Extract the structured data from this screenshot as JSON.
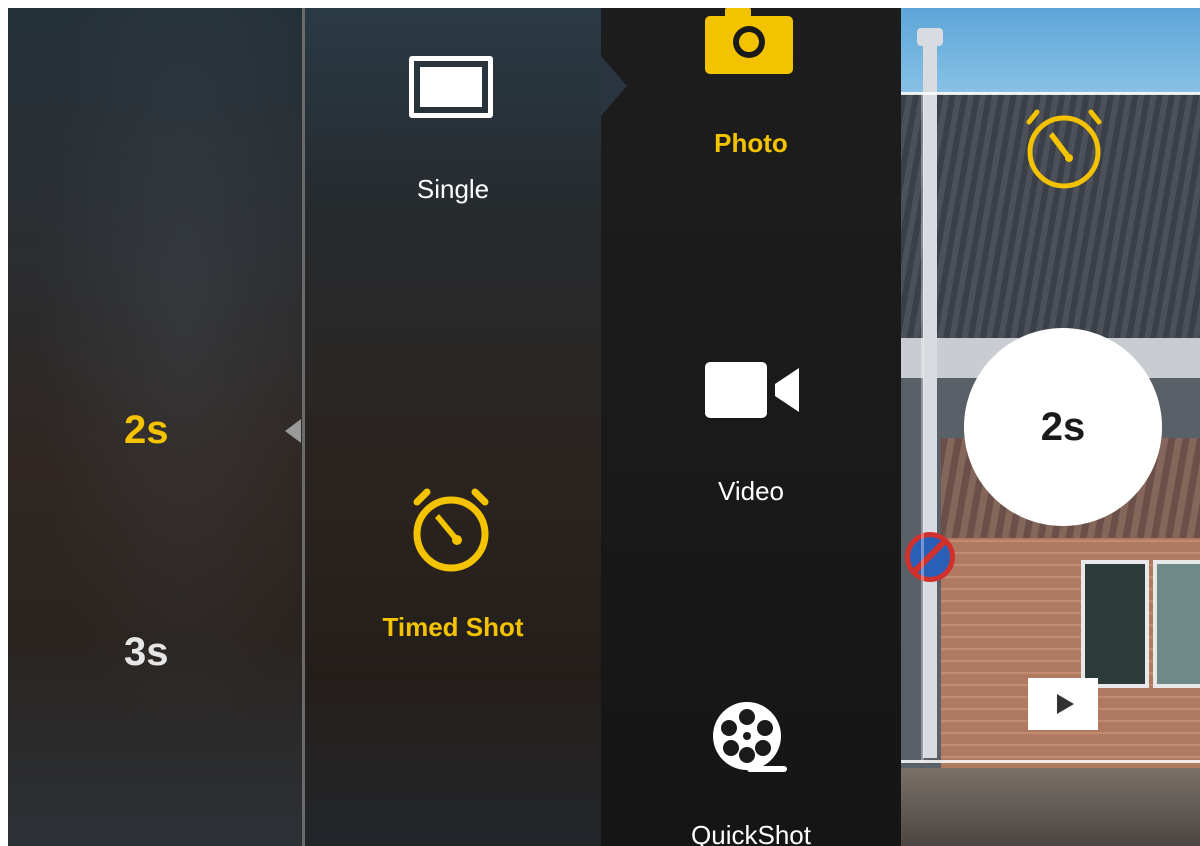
{
  "timer_menu": {
    "options": [
      {
        "label": "2s",
        "selected": true
      },
      {
        "label": "3s",
        "selected": false
      }
    ]
  },
  "photo_modes": {
    "single": {
      "label": "Single",
      "icon": "single-frame-icon"
    },
    "timed_shot": {
      "label": "Timed Shot",
      "icon": "stopwatch-icon",
      "selected": true
    }
  },
  "capture_types": {
    "photo": {
      "label": "Photo",
      "icon": "camera-icon",
      "selected": true
    },
    "video": {
      "label": "Video",
      "icon": "video-camera-icon"
    },
    "quickshot": {
      "label": "QuickShot",
      "icon": "film-reel-icon"
    }
  },
  "preview": {
    "shutter_label": "2s",
    "timer_indicator_icon": "stopwatch-icon",
    "playback_icon": "play-icon"
  },
  "colors": {
    "accent": "#f3c300",
    "text": "#ffffff",
    "shutter_bg": "#ffffff"
  }
}
